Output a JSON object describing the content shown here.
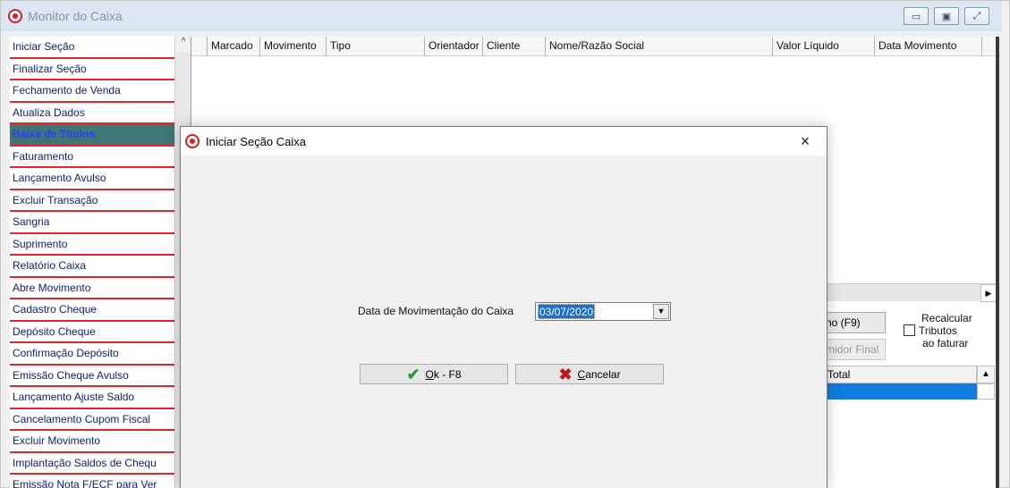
{
  "window": {
    "title": "Monitor do Caixa",
    "buttons": [
      "▭",
      "▣",
      "⤢"
    ]
  },
  "sidebar": {
    "items": [
      {
        "label": "Iniciar Seção"
      },
      {
        "label": "Finalizar Seção"
      },
      {
        "label": "Fechamento de Venda"
      },
      {
        "label": "Atualiza Dados"
      },
      {
        "label": "Baixa de Títulos",
        "active": true
      },
      {
        "label": "Faturamento"
      },
      {
        "label": "Lançamento Avulso"
      },
      {
        "label": "Excluir Transação"
      },
      {
        "label": "Sangria"
      },
      {
        "label": "Suprimento"
      },
      {
        "label": "Relatório Caixa"
      },
      {
        "label": "Abre Movimento"
      },
      {
        "label": "Cadastro Cheque"
      },
      {
        "label": "Depósito Cheque"
      },
      {
        "label": "Confirmação Depósito"
      },
      {
        "label": "Emissão Cheque Avulso"
      },
      {
        "label": "Lançamento Ajuste Saldo"
      },
      {
        "label": "Cancelamento Cupom Fiscal"
      },
      {
        "label": "Excluir Movimento"
      },
      {
        "label": "Implantação Saldos de Chequ"
      },
      {
        "label": "Emissão Nota F/ECF para Ver"
      }
    ],
    "scroll_arrow": "^"
  },
  "grid": {
    "columns": [
      "Marcado",
      "Movimento",
      "Tipo",
      "Orientador",
      "Cliente",
      "Nome/Razão Social",
      "Valor Líquido",
      "Data Movimento"
    ]
  },
  "side_controls": {
    "f9_button": "no (F9)",
    "consumer_button": "midor Final",
    "recalc_line1": "Recalcular",
    "recalc_line2": "Tributos",
    "recalc_line3": "ao faturar",
    "total_header": "Total"
  },
  "dialog": {
    "title": "Iniciar Seção Caixa",
    "close": "×",
    "field_label": "Data de Movimentação do Caixa",
    "date_value": "03/07/2020",
    "ok_label_underlined": "O",
    "ok_label_rest": "k - F8",
    "cancel_label_underlined": "C",
    "cancel_label_rest": "ancelar"
  }
}
